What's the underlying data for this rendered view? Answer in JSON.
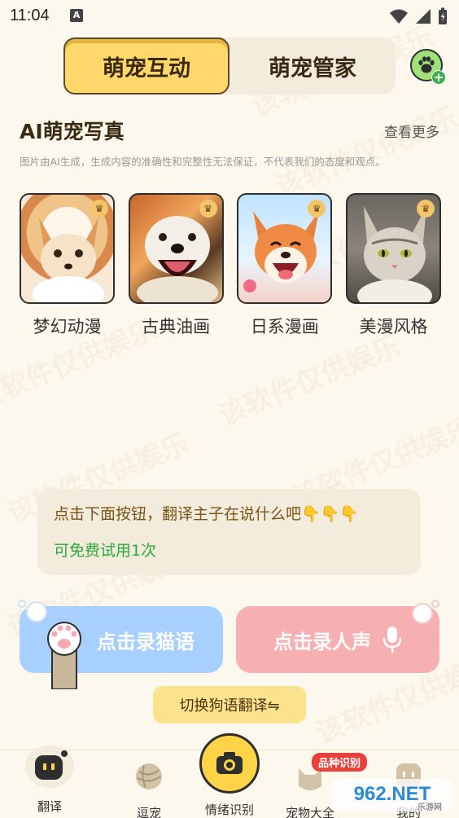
{
  "status_bar": {
    "time": "11:04",
    "notif_letter": "A"
  },
  "tabs": {
    "active": "萌宠互动",
    "inactive": "萌宠管家"
  },
  "section": {
    "title": "AI萌宠写真",
    "more": "查看更多",
    "disclaimer": "图片由AI生成，生成内容的准确性和完整性无法保证，不代表我们的态度和观点。"
  },
  "styles": [
    {
      "label": "梦幻动漫"
    },
    {
      "label": "古典油画"
    },
    {
      "label": "日系漫画"
    },
    {
      "label": "美漫风格"
    }
  ],
  "prompt": {
    "text": "点击下面按钮，翻译主子在说什么吧👇👇👇",
    "trial": "可免费试用1次"
  },
  "record": {
    "cat": "点击录猫语",
    "human": "点击录人声"
  },
  "switch_label": "切换狗语翻译⇋",
  "nav": {
    "translate": "翻译",
    "tease": "逗宠",
    "emotion": "情绪识别",
    "encyclopedia": "宠物大全",
    "mine": "我的",
    "breed_badge": "品种识别"
  },
  "watermark": "该软件仅供娱乐",
  "brand": {
    "text": "962.NET",
    "sub": "乐游网"
  },
  "colors": {
    "accent": "#ffd76a",
    "cat_btn": "#a7d0ff",
    "human_btn": "#f7b0b2",
    "trial_green": "#2ba83a"
  }
}
